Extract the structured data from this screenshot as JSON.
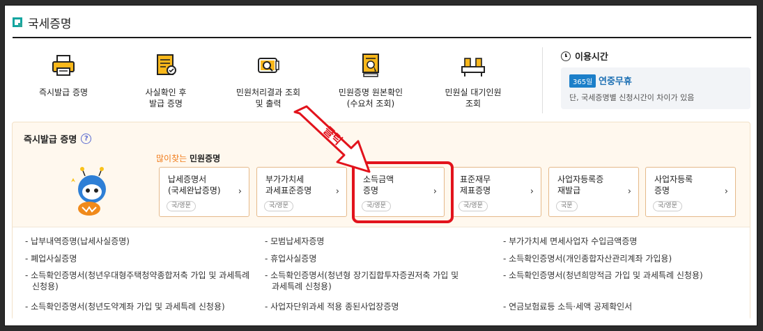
{
  "title": "국세증명",
  "services": [
    {
      "label_line1": "즉시발급 증명",
      "label_line2": "",
      "icon": "printer-icon"
    },
    {
      "label_line1": "사실확인 후",
      "label_line2": "발급 증명",
      "icon": "document-check-icon"
    },
    {
      "label_line1": "민원처리결과 조회",
      "label_line2": "및 출력",
      "icon": "scroll-search-icon"
    },
    {
      "label_line1": "민원증명 원본확인",
      "label_line2": "(수요처 조회)",
      "icon": "document-stamp-icon"
    },
    {
      "label_line1": "민원실 대기인원",
      "label_line2": "조회",
      "icon": "waiting-counter-icon"
    }
  ],
  "hours": {
    "title": "이용시간",
    "badge": "365일",
    "main": "연중무휴",
    "note": "단, 국세증명별 신청시간이 차이가 있음"
  },
  "instant": {
    "title": "즉시발급 증명",
    "help": "?",
    "popular_highlight": "많이찾는",
    "popular_rest": "민원증명",
    "click_label": "클릭",
    "cards": [
      {
        "line1": "납세증명서",
        "line2": "(국세완납증명)",
        "tag": "국/영문"
      },
      {
        "line1": "부가가치세",
        "line2": "과세표준증명",
        "tag": "국/영문"
      },
      {
        "line1": "소득금액",
        "line2": "증명",
        "tag": "국/영문"
      },
      {
        "line1": "표준재무",
        "line2": "제표증명",
        "tag": "국/영문"
      },
      {
        "line1": "사업자등록증",
        "line2": "재발급",
        "tag": "국문"
      },
      {
        "line1": "사업자등록",
        "line2": "증명",
        "tag": "국/영문"
      }
    ],
    "links": [
      "- 납부내역증명(납세사실증명)",
      "- 모범납세자증명",
      "- 부가가치세 면세사업자 수입금액증명",
      "- 폐업사실증명",
      "- 휴업사실증명",
      "- 소득확인증명서(개인종합자산관리계좌 가입용)",
      "- 소득확인증명서(청년우대형주택청약종합저축 가입 및 과세특례",
      "신청용)",
      "- 소득확인증명서(청년형 장기집합투자증권저축 가입 및",
      "과세특례 신청용)",
      "- 소득확인증명서(청년희망적금 가입 및 과세특례 신청용)",
      "- 소득확인증명서(청년도약계좌 가입 및 과세특례 신청용)",
      "- 사업자단위과세 적용 종된사업장증명",
      "- 연금보험료등 소득·세액 공제확인서"
    ]
  }
}
